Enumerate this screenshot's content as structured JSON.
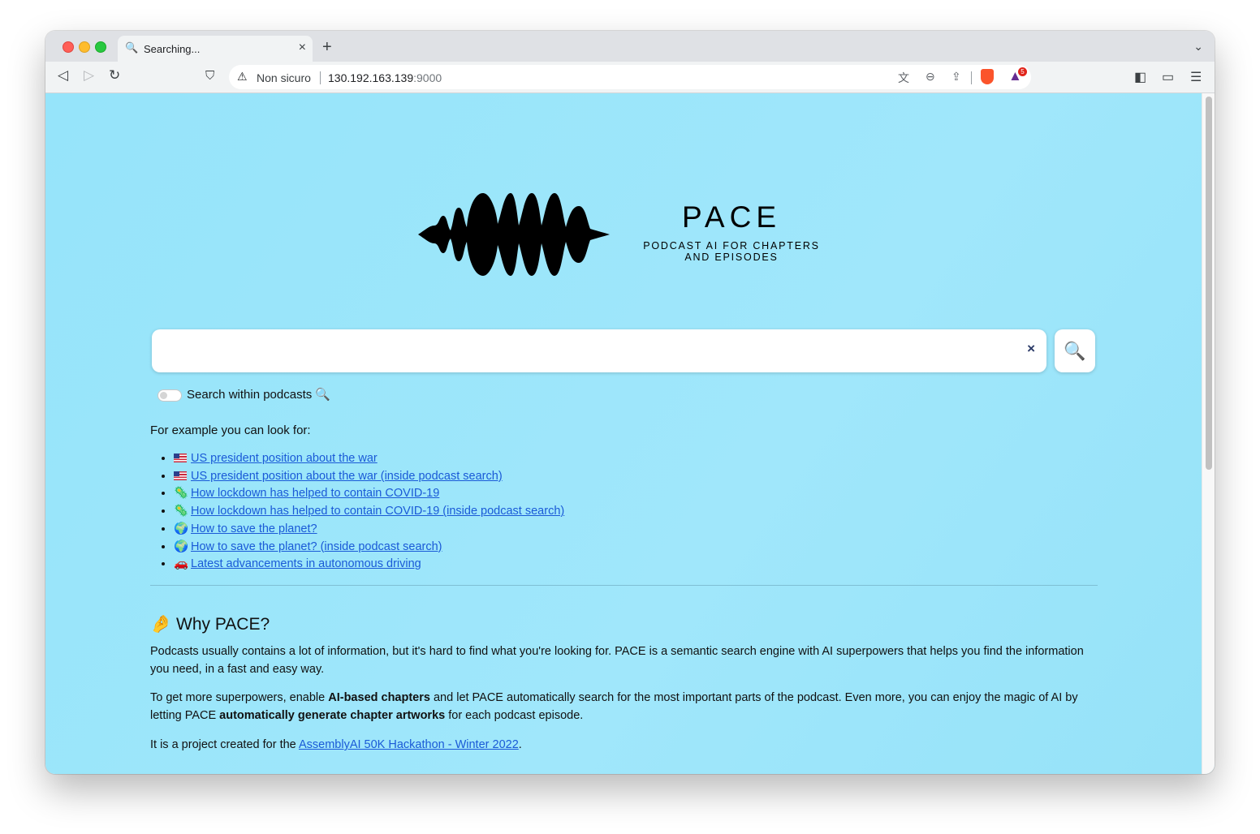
{
  "browser": {
    "tab": {
      "title": "Searching...",
      "icon": "search-icon"
    },
    "omnibox": {
      "security_label": "Non sicuro",
      "url_host": "130.192.163.139",
      "url_port": ":9000"
    },
    "rewards_badge": "5"
  },
  "brand": {
    "name": "PACE",
    "tagline_line1": "PODCAST AI FOR CHAPTERS",
    "tagline_line2": "AND EPISODES"
  },
  "search": {
    "value": "",
    "placeholder": "",
    "clear_symbol": "×",
    "button_icon": "🔍"
  },
  "toggle": {
    "label": "Search within podcasts 🔍",
    "enabled": false
  },
  "examples": {
    "intro": "For example you can look for:",
    "items": [
      {
        "icon": "us-flag-icon",
        "label": "US president position about the war"
      },
      {
        "icon": "us-flag-icon",
        "label": "US president position about the war (inside podcast search)"
      },
      {
        "icon": "virus-icon",
        "emoji": "🦠",
        "label": "How lockdown has helped to contain COVID-19"
      },
      {
        "icon": "virus-icon",
        "emoji": "🦠",
        "label": "How lockdown has helped to contain COVID-19 (inside podcast search)"
      },
      {
        "icon": "globe-icon",
        "emoji": "🌍",
        "label": "How to save the planet?"
      },
      {
        "icon": "globe-icon",
        "emoji": "🌍",
        "label": "How to save the planet? (inside podcast search)"
      },
      {
        "icon": "car-icon",
        "emoji": "🚗",
        "label": "Latest advancements in autonomous driving"
      }
    ]
  },
  "why": {
    "emoji": "🤌",
    "title": "Why PACE?",
    "p1": "Podcasts usually contains a lot of information, but it's hard to find what you're looking for. PACE is a semantic search engine with AI superpowers that helps you find the information you need, in a fast and easy way.",
    "p2_a": "To get more superpowers, enable ",
    "p2_b": "AI-based chapters",
    "p2_c": " and let PACE automatically search for the most important parts of the podcast. Even more, you can enjoy the magic of AI by letting PACE ",
    "p2_d": "automatically generate chapter artworks",
    "p2_e": " for each podcast episode.",
    "p3_a": "It is a project created for the ",
    "p3_link": "AssemblyAI 50K Hackathon - Winter 2022",
    "p3_b": "."
  },
  "colors": {
    "page_bg": "#9ce5fa",
    "link": "#1a5ad7",
    "brave_orange": "#fb542b"
  }
}
